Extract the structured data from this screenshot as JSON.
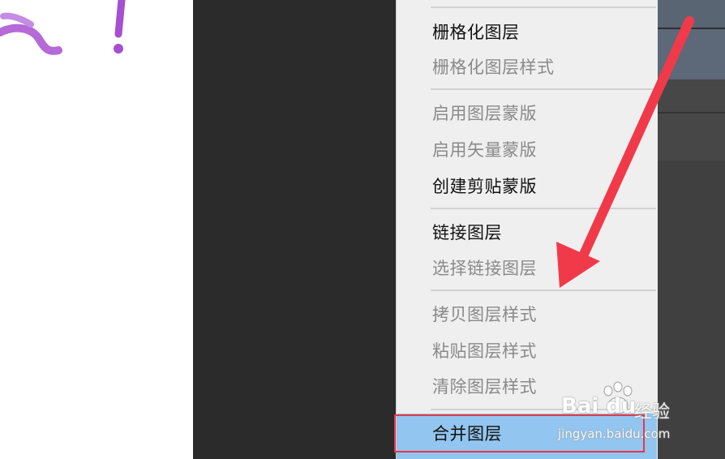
{
  "menu": {
    "items": [
      {
        "label": "栅格化图层",
        "enabled": true
      },
      {
        "label": "栅格化图层样式",
        "enabled": false
      },
      {
        "label": "启用图层蒙版",
        "enabled": false
      },
      {
        "label": "启用矢量蒙版",
        "enabled": false
      },
      {
        "label": "创建剪贴蒙版",
        "enabled": true
      },
      {
        "label": "链接图层",
        "enabled": true
      },
      {
        "label": "选择链接图层",
        "enabled": false
      },
      {
        "label": "拷贝图层样式",
        "enabled": false
      },
      {
        "label": "粘贴图层样式",
        "enabled": false
      },
      {
        "label": "清除图层样式",
        "enabled": false
      },
      {
        "label": "合并图层",
        "enabled": true,
        "highlighted": true
      }
    ]
  },
  "watermark": {
    "brand": "Bai du",
    "product": "经验",
    "url": "jingyan.baidu.com"
  },
  "colors": {
    "menu_bg": "#efefef",
    "highlight": "#92c5ef",
    "annotation_red": "#e53945",
    "dark_panel": "#2b2b2b",
    "right_panel": "#4a4a4a",
    "art_purple": "#a64fd1"
  }
}
